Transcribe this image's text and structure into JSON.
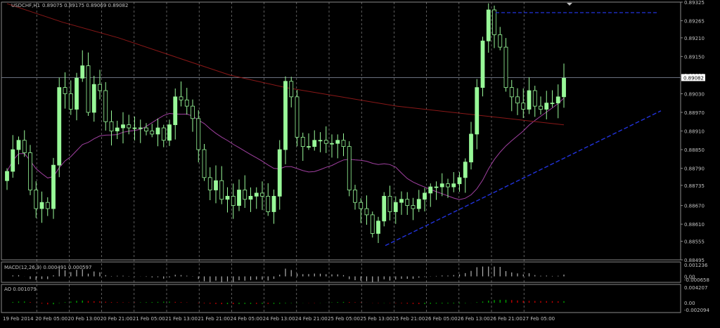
{
  "window": {
    "symbol_label": "USDCHF,H1",
    "ohlc_label": "0.89075 0.89175 0.89069 0.89082"
  },
  "panes": {
    "macd_label": "MACD(12,26,9) 0.000491 0.000597",
    "ao_label": "AO 0.001079"
  },
  "colors": {
    "background": "#000000",
    "bull_candle": "#98f898",
    "bear_candle": "#206020",
    "ma_fast": "#a040a0",
    "ma_slow": "#8a1818",
    "trendline": "#2233dd",
    "grid": "#9a9a9a",
    "price_line": "#7a8090",
    "macd_hist": "#b0b0b0",
    "macd_signal": "#d03030",
    "ao_up": "#00a000",
    "ao_down": "#c00000"
  },
  "chart_data": {
    "type": "candlestick",
    "title": "USDCHF,H1",
    "ylim": [
      0.88495,
      0.89325
    ],
    "current_price": 0.89082,
    "y_ticks": [
      "0.89325",
      "0.89265",
      "0.89210",
      "0.89150",
      "0.89090",
      "0.89030",
      "0.88970",
      "0.88910",
      "0.88850",
      "0.88790",
      "0.88735",
      "0.88670",
      "0.88610",
      "0.88555",
      "0.88495"
    ],
    "x_ticks": [
      "19 Feb 2014",
      "20 Feb 05:00",
      "20 Feb 13:00",
      "20 Feb 21:00",
      "21 Feb 05:00",
      "21 Feb 13:00",
      "21 Feb 21:00",
      "24 Feb 05:00",
      "24 Feb 13:00",
      "24 Feb 21:00",
      "25 Feb 05:00",
      "25 Feb 13:00",
      "25 Feb 21:00",
      "26 Feb 05:00",
      "26 Feb 13:00",
      "26 Feb 21:00",
      "27 Feb 05:00"
    ],
    "close_path": [
      0.8878,
      0.8885,
      0.8888,
      0.8884,
      0.8872,
      0.8866,
      0.8868,
      0.8866,
      0.888,
      0.8905,
      0.8903,
      0.8898,
      0.8908,
      0.8912,
      0.8897,
      0.8906,
      0.8904,
      0.8894,
      0.8891,
      0.8892,
      0.8893,
      0.8892,
      0.8892,
      0.8892,
      0.8891,
      0.889,
      0.8892,
      0.8888,
      0.8893,
      0.8902,
      0.8901,
      0.8899,
      0.8895,
      0.8885,
      0.8876,
      0.8872,
      0.8875,
      0.8869,
      0.887,
      0.8867,
      0.8872,
      0.8869,
      0.887,
      0.8871,
      0.887,
      0.8865,
      0.887,
      0.8885,
      0.8907,
      0.8902,
      0.8889,
      0.8886,
      0.8886,
      0.8888,
      0.8888,
      0.8887,
      0.8887,
      0.8888,
      0.8886,
      0.8872,
      0.8868,
      0.8866,
      0.8864,
      0.8858,
      0.8862,
      0.887,
      0.8865,
      0.8868,
      0.8869,
      0.8867,
      0.8866,
      0.8869,
      0.8871,
      0.8873,
      0.8873,
      0.8874,
      0.8873,
      0.8874,
      0.8876,
      0.8881,
      0.889,
      0.8905,
      0.892,
      0.893,
      0.8922,
      0.8918,
      0.8905,
      0.8902,
      0.89,
      0.8898,
      0.8904,
      0.8899,
      0.8898,
      0.89,
      0.89,
      0.8902,
      0.8908
    ],
    "trendline_support": [
      [
        0,
        0.88541
      ],
      [
        1,
        0.88975
      ]
    ],
    "resistance_level": 0.89291,
    "macd": {
      "value": 0.000491,
      "signal": 0.000597,
      "y_ticks": [
        "0.001236",
        "0.00",
        "-0.000658"
      ]
    },
    "ao": {
      "value": 0.001079,
      "y_ticks": [
        "0.004207",
        "0.00",
        "-0.002094"
      ]
    }
  }
}
